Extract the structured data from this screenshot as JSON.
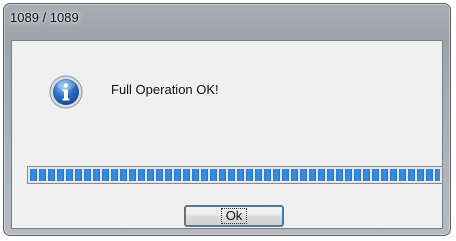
{
  "window": {
    "title": "1089 / 1089"
  },
  "dialog": {
    "icon": "info-icon",
    "message": "Full Operation OK!",
    "progress": 1.0,
    "ok_label": "Ok"
  },
  "colors": {
    "progress": "#2a7fd4",
    "frame": "#a9aeb5",
    "content_bg": "#f0f0f0"
  }
}
